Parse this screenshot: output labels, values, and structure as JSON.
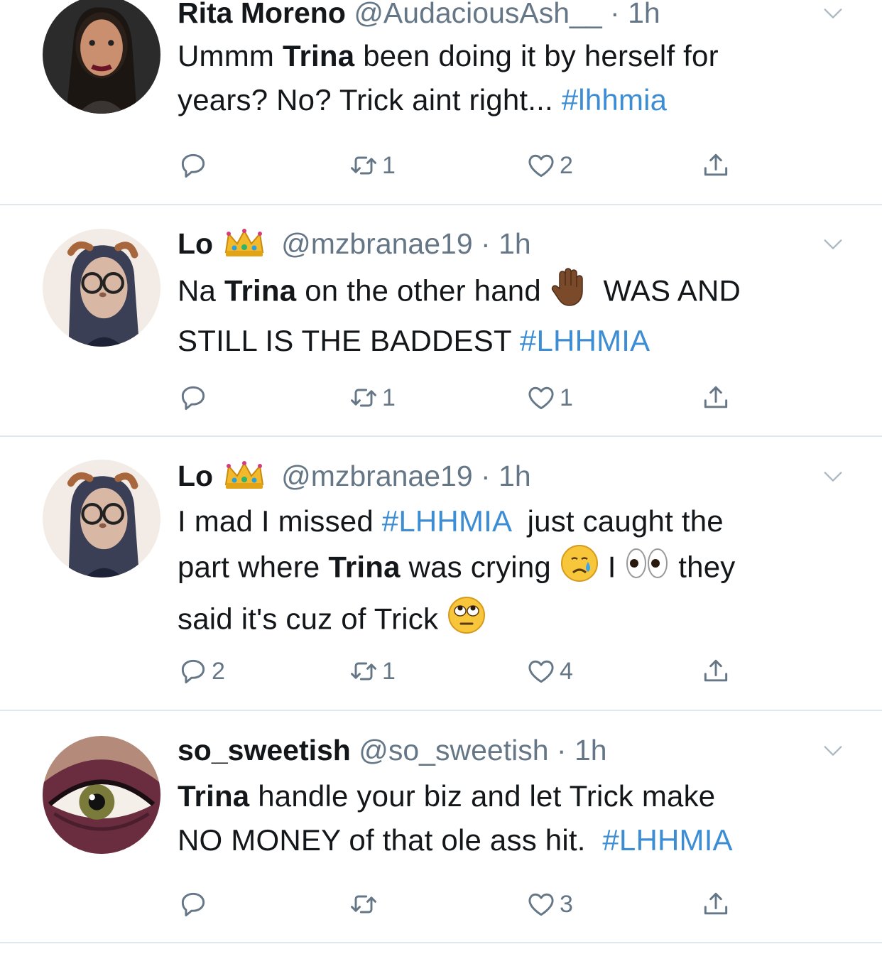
{
  "tweets": [
    {
      "name": "Rita Moreno",
      "handle": "@AudaciousAsh__",
      "time": "1h",
      "lines": [
        [
          {
            "t": "Ummm "
          },
          {
            "t": "Trina",
            "b": true
          },
          {
            "t": " been doing it by herself for"
          }
        ],
        [
          {
            "t": "years? No? Trick aint right... "
          },
          {
            "t": "#lhhmia",
            "tag": true
          }
        ]
      ],
      "replies": "",
      "retweets": "1",
      "likes": "2",
      "avatar_icon": "woman-portrait-avatar"
    },
    {
      "name": "Lo",
      "name_emoji": "crown",
      "handle": "@mzbranae19",
      "time": "1h",
      "lines": [
        [
          {
            "t": "Na "
          },
          {
            "t": "Trina",
            "b": true
          },
          {
            "t": " on the other hand "
          },
          {
            "e": "raised-hand"
          },
          {
            "t": "  WAS AND"
          }
        ],
        [
          {
            "t": "STILL IS THE BADDEST "
          },
          {
            "t": "#LHHMIA",
            "tag": true
          }
        ]
      ],
      "replies": "",
      "retweets": "1",
      "likes": "1",
      "avatar_icon": "snapchat-filter-avatar"
    },
    {
      "name": "Lo",
      "name_emoji": "crown",
      "handle": "@mzbranae19",
      "time": "1h",
      "lines": [
        [
          {
            "t": "I mad I missed "
          },
          {
            "t": "#LHHMIA",
            "tag": true
          },
          {
            "t": "  just caught the"
          }
        ],
        [
          {
            "t": "part where "
          },
          {
            "t": "Trina",
            "b": true
          },
          {
            "t": " was crying "
          },
          {
            "e": "crying-face"
          },
          {
            "t": " I "
          },
          {
            "e": "eyes"
          },
          {
            "t": " they"
          }
        ],
        [
          {
            "t": "said it's cuz of Trick "
          },
          {
            "e": "eye-roll"
          }
        ]
      ],
      "replies": "2",
      "retweets": "1",
      "likes": "4",
      "avatar_icon": "snapchat-filter-avatar"
    },
    {
      "name": "so_sweetish",
      "handle": "@so_sweetish",
      "time": "1h",
      "lines": [
        [
          {
            "t": "Trina",
            "b": true
          },
          {
            "t": " handle your biz and let Trick make"
          }
        ],
        [
          {
            "t": "NO MONEY of that ole ass hit.  "
          },
          {
            "t": "#LHHMIA",
            "tag": true
          }
        ]
      ],
      "replies": "",
      "retweets": "",
      "likes": "3",
      "avatar_icon": "eye-closeup-avatar"
    }
  ],
  "colors": {
    "text": "#14171a",
    "muted": "#657786",
    "hashtag": "#3c8dd4",
    "divider": "#e1e8ed"
  }
}
